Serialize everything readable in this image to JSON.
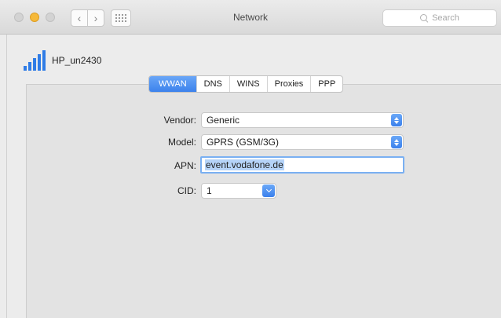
{
  "window": {
    "title": "Network",
    "search_placeholder": "Search"
  },
  "device": {
    "name": "HP_un2430"
  },
  "tabs": [
    {
      "label": "WWAN",
      "active": true
    },
    {
      "label": "DNS",
      "active": false
    },
    {
      "label": "WINS",
      "active": false
    },
    {
      "label": "Proxies",
      "active": false
    },
    {
      "label": "PPP",
      "active": false
    }
  ],
  "form": {
    "vendor": {
      "label": "Vendor:",
      "value": "Generic"
    },
    "model": {
      "label": "Model:",
      "value": "GPRS (GSM/3G)"
    },
    "apn": {
      "label": "APN:",
      "value": "event.vodafone.de"
    },
    "cid": {
      "label": "CID:",
      "value": "1"
    }
  },
  "colors": {
    "accent": "#3c82ec",
    "minimize": "#f6b93a"
  }
}
